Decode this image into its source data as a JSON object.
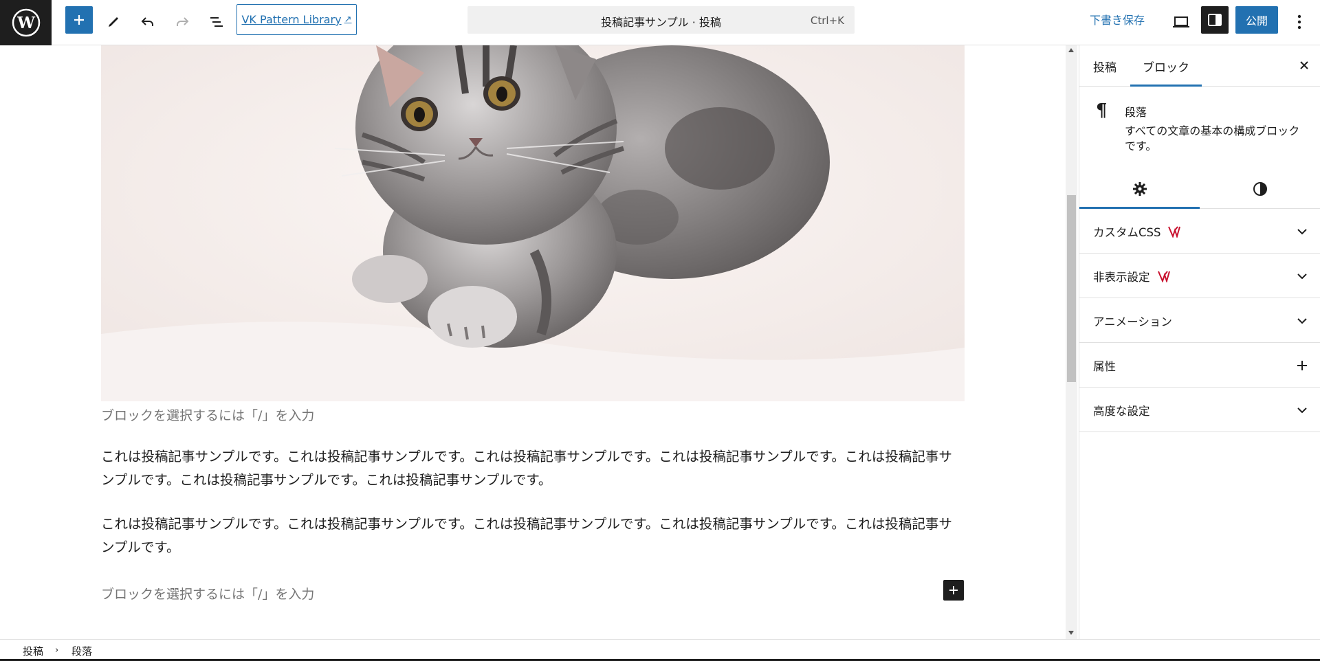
{
  "topbar": {
    "vk_link_label": "VK Pattern Library",
    "vk_link_arrow": "↗",
    "command_title": "投稿記事サンプル · 投稿",
    "command_shortcut": "Ctrl+K",
    "save_draft_label": "下書き保存",
    "publish_label": "公開",
    "icons": [
      "wordpress-logo-icon",
      "plus-icon",
      "pencil-icon",
      "undo-icon",
      "redo-icon",
      "list-view-icon",
      "desktop-preview-icon",
      "sidebar-toggle-icon",
      "more-vertical-icon"
    ]
  },
  "editor": {
    "placeholder_top": "ブロックを選択するには「/」を入力",
    "paragraph_1": "これは投稿記事サンプルです。これは投稿記事サンプルです。これは投稿記事サンプルです。これは投稿記事サンプルです。これは投稿記事サンプルです。これは投稿記事サンプルです。これは投稿記事サンプルです。",
    "paragraph_2": "これは投稿記事サンプルです。これは投稿記事サンプルです。これは投稿記事サンプルです。これは投稿記事サンプルです。これは投稿記事サンプルです。",
    "placeholder_bottom": "ブロックを選択するには「/」を入力"
  },
  "sidebar": {
    "tab_post": "投稿",
    "tab_block": "ブロック",
    "active_tab": "ブロック",
    "block_name": "段落",
    "block_description": "すべての文章の基本の構成ブロックです。",
    "panels": [
      {
        "label": "カスタムCSS",
        "vk_badge": true,
        "state": "collapsed"
      },
      {
        "label": "非表示設定",
        "vk_badge": true,
        "state": "collapsed"
      },
      {
        "label": "アニメーション",
        "vk_badge": false,
        "state": "collapsed"
      },
      {
        "label": "属性",
        "vk_badge": false,
        "state": "addable"
      },
      {
        "label": "高度な設定",
        "vk_badge": false,
        "state": "collapsed"
      }
    ]
  },
  "breadcrumb": {
    "items": [
      "投稿",
      "段落"
    ],
    "separator": "›"
  },
  "colors": {
    "accent": "#2271b1",
    "dark": "#1e1e1e",
    "vk_badge": "#c8102e"
  }
}
